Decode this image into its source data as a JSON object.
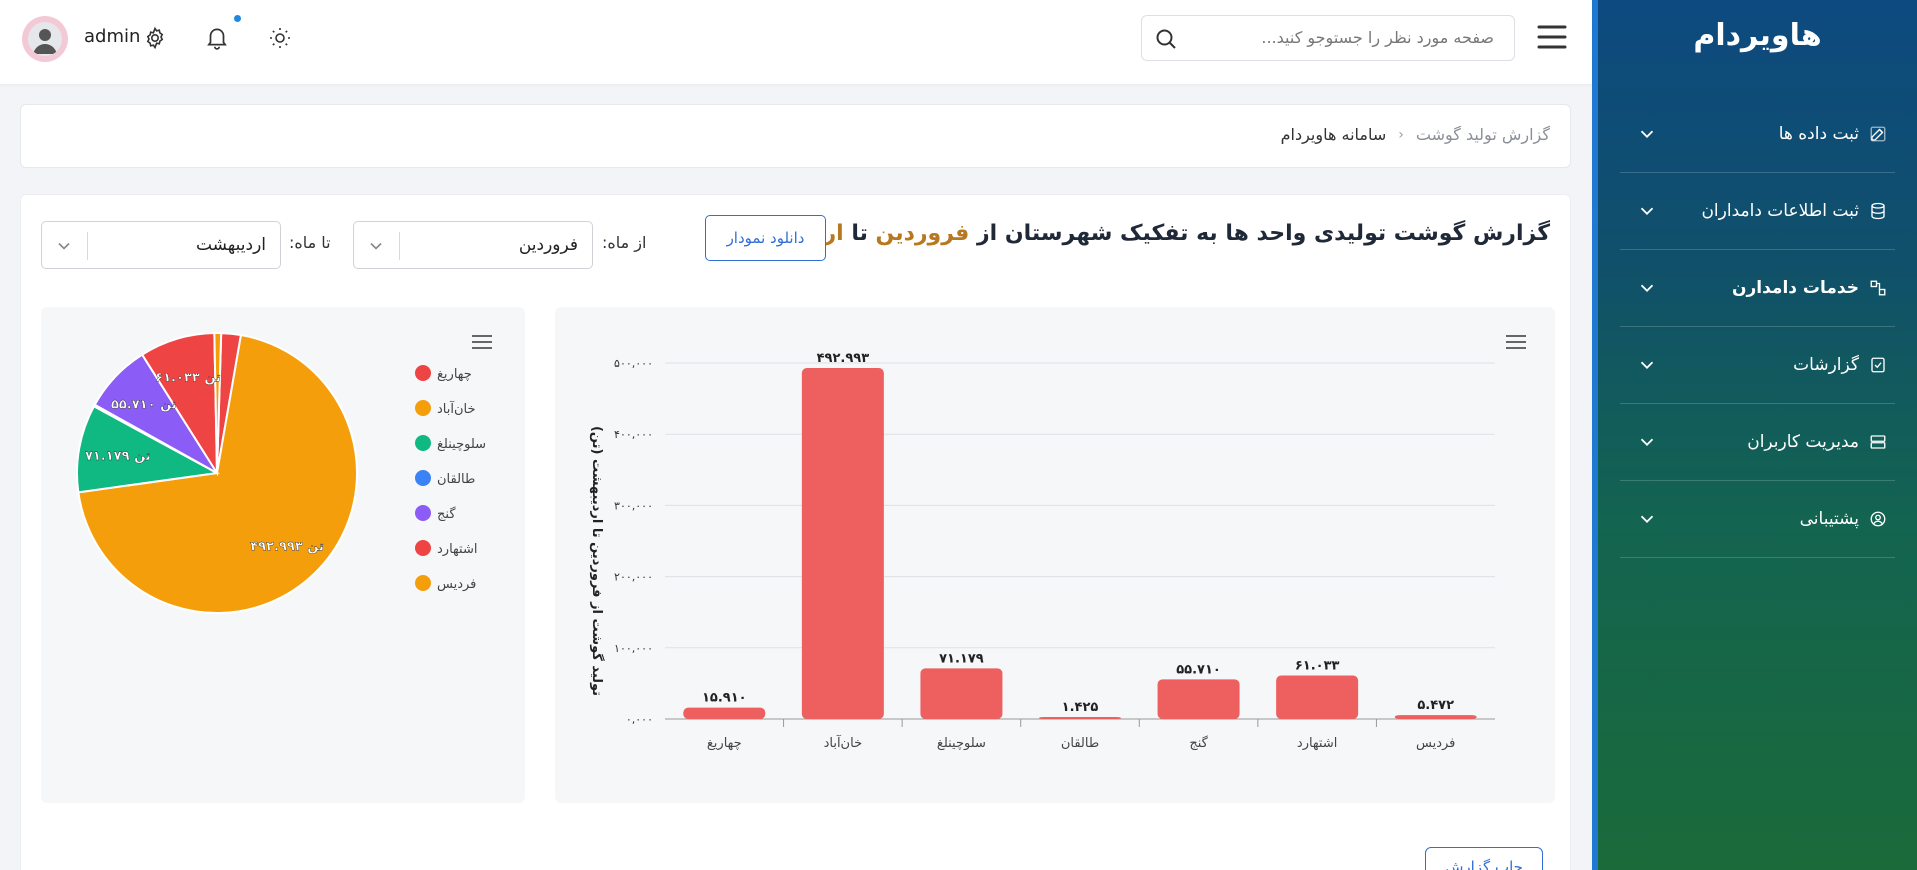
{
  "sidebar": {
    "title": "هاویردام",
    "items": [
      {
        "label": "ثبت داده ها",
        "icon": "edit-icon"
      },
      {
        "label": "ثبت اطلاعات دامداران",
        "icon": "database-icon"
      },
      {
        "label": "خدمات دامدارن",
        "icon": "flow-icon"
      },
      {
        "label": "گزارشات",
        "icon": "checklist-icon"
      },
      {
        "label": "مدیریت کاربران",
        "icon": "server-icon"
      },
      {
        "label": "پشتیبانی",
        "icon": "user-circle-icon"
      }
    ]
  },
  "topbar": {
    "user": "admin",
    "search_placeholder": "صفحه مورد نظر را جستوجو کنید..."
  },
  "breadcrumb": {
    "items": [
      "گزارش تولید گوشت",
      "سامانه هاویردام"
    ],
    "separator": "‹"
  },
  "report": {
    "title_prefix": "گزارش گوشت تولیدی واحد ها به تفکیک شهرستان از",
    "from_value": "فروردین",
    "title_mid": "تا",
    "to_value": "اردیبهشت",
    "download_label": "دانلود نمودار",
    "from_label": "از ماه:",
    "to_label": "تا ماه:",
    "print_label": "چاپ گزارش"
  },
  "colors": {
    "bar": "#ee5f5f",
    "highlight": "#b7791f",
    "accent": "#2f6fd6"
  },
  "chart_data": [
    {
      "type": "bar",
      "categories": [
        "چهاریغ",
        "خان‌آباد",
        "سلوچینلغ",
        "طالقان",
        "گنج",
        "اشتهارد",
        "فردیس"
      ],
      "values": [
        15910,
        492993,
        71179,
        1425,
        55710,
        61033,
        5472
      ],
      "value_labels": [
        "۱۵.۹۱۰",
        "۴۹۲.۹۹۳",
        "۷۱.۱۷۹",
        "۱.۴۲۵",
        "۵۵.۷۱۰",
        "۶۱.۰۳۳",
        "۵.۴۷۲"
      ],
      "y_ticks": [
        "۰,۰۰۰",
        "۱۰۰,۰۰۰",
        "۲۰۰,۰۰۰",
        "۳۰۰,۰۰۰",
        "۴۰۰,۰۰۰",
        "۵۰۰,۰۰۰"
      ],
      "ylabel": "تولید گوشت از فروردین تا اردیبهشت (تن)",
      "ylim": [
        0,
        500000
      ],
      "grid": true
    },
    {
      "type": "pie",
      "categories": [
        "چهاریغ",
        "خان‌آباد",
        "سلوچینلغ",
        "طالقان",
        "گنج",
        "اشتهارد",
        "فردیس"
      ],
      "values": [
        15910,
        492993,
        71179,
        1425,
        55710,
        61033,
        5472
      ],
      "colors": [
        "#ef4444",
        "#f59e0b",
        "#10b981",
        "#3b82f6",
        "#8b5cf6",
        "#ef4444",
        "#f59e0b"
      ],
      "slice_labels": [
        "",
        "تن ۴۹۲.۹۹۳",
        "تن ۷۱.۱۷۹",
        "",
        "تن ۵۵.۷۱۰",
        "تن ۶۱.۰۳۳",
        ""
      ],
      "legend_position": "right"
    }
  ]
}
